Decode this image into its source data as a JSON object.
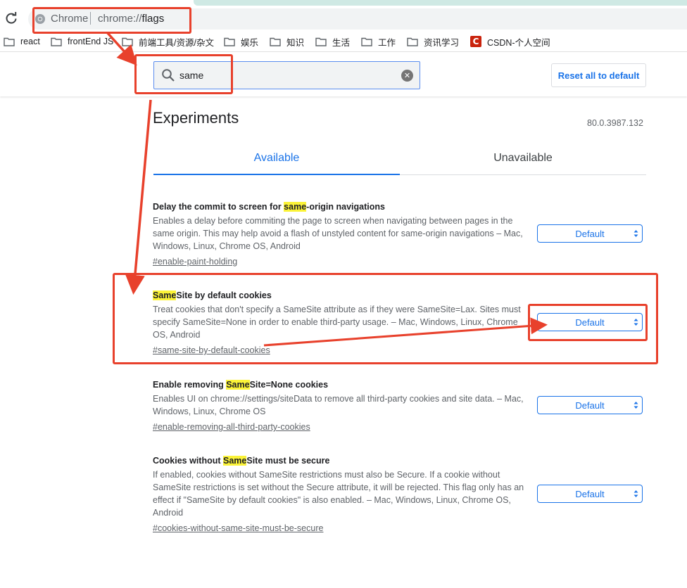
{
  "browser": {
    "omnibox_scheme": "Chrome",
    "omnibox_url_prefix": "chrome://",
    "omnibox_url_host": "flags",
    "bookmarks": [
      {
        "label": "react",
        "icon": "folder-icon"
      },
      {
        "label": "frontEnd JS",
        "icon": "folder-icon"
      },
      {
        "label": "前端工具/资源/杂文",
        "icon": "folder-icon"
      },
      {
        "label": "娱乐",
        "icon": "folder-icon"
      },
      {
        "label": "知识",
        "icon": "folder-icon"
      },
      {
        "label": "生活",
        "icon": "folder-icon"
      },
      {
        "label": "工作",
        "icon": "folder-icon"
      },
      {
        "label": "资讯学习",
        "icon": "folder-icon"
      },
      {
        "label": "CSDN-个人空间",
        "icon": "csdn-icon",
        "icon_text": "C"
      }
    ]
  },
  "header": {
    "search_value": "same",
    "clear_glyph": "✕",
    "reset_label": "Reset all to default"
  },
  "page": {
    "title": "Experiments",
    "version": "80.0.3987.132",
    "tabs": [
      {
        "label": "Available",
        "active": true
      },
      {
        "label": "Unavailable",
        "active": false
      }
    ]
  },
  "experiments": [
    {
      "name_before": "Delay the commit to screen for ",
      "name_match": "same",
      "name_after": "-origin navigations",
      "description": "Enables a delay before commiting the page to screen when navigating between pages in the same origin. This may help avoid a flash of unstyled content for same-origin navigations – Mac, Windows, Linux, Chrome OS, Android",
      "link": "#enable-paint-holding",
      "value": "Default"
    },
    {
      "name_before": "",
      "name_match": "Same",
      "name_after": "Site by default cookies",
      "description": "Treat cookies that don't specify a SameSite attribute as if they were SameSite=Lax. Sites must specify SameSite=None in order to enable third-party usage. – Mac, Windows, Linux, Chrome OS, Android",
      "link": "#same-site-by-default-cookies",
      "value": "Default"
    },
    {
      "name_before": "Enable removing ",
      "name_match": "Same",
      "name_after": "Site=None cookies",
      "description": "Enables UI on chrome://settings/siteData to remove all third-party cookies and site data. – Mac, Windows, Linux, Chrome OS",
      "link": "#enable-removing-all-third-party-cookies",
      "value": "Default"
    },
    {
      "name_before": "Cookies without ",
      "name_match": "Same",
      "name_after": "Site must be secure",
      "description": "If enabled, cookies without SameSite restrictions must also be Secure. If a cookie without SameSite restrictions is set without the Secure attribute, it will be rejected. This flag only has an effect if \"SameSite by default cookies\" is also enabled. – Mac, Windows, Linux, Chrome OS, Android",
      "link": "#cookies-without-same-site-must-be-secure",
      "value": "Default"
    }
  ],
  "colors": {
    "accent": "#1a73e8",
    "highlight": "#fbf338",
    "annotation": "#e8412c"
  }
}
